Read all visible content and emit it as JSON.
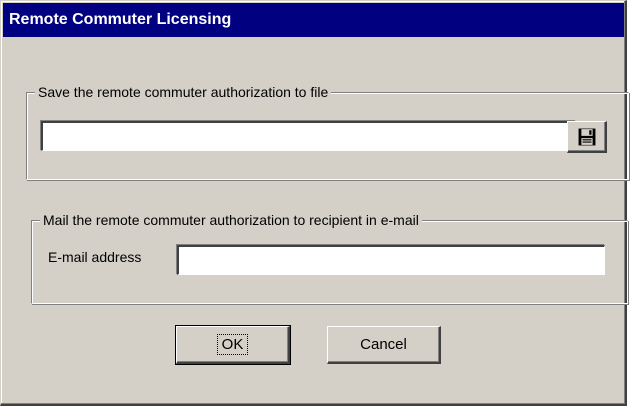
{
  "window": {
    "title": "Remote Commuter Licensing"
  },
  "file_group": {
    "legend": "Save the remote commuter authorization to file",
    "path_value": "",
    "save_icon": "floppy-disk-icon"
  },
  "mail_group": {
    "legend": "Mail the remote commuter authorization to recipient in e-mail",
    "email_label": "E-mail address",
    "email_value": ""
  },
  "buttons": {
    "ok": "OK",
    "cancel": "Cancel"
  },
  "colors": {
    "title_bar": "#000080",
    "dialog_face": "#d4d0c8",
    "title_text": "#ffffff"
  }
}
